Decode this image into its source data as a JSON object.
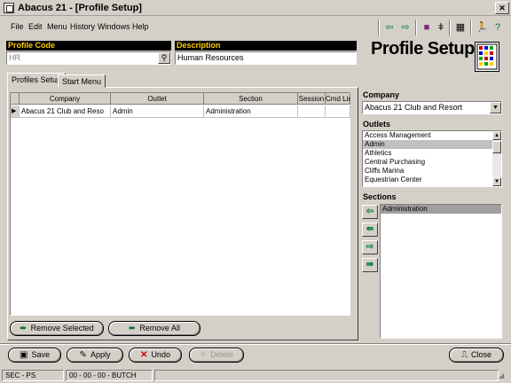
{
  "window": {
    "title": "Abacus 21 - [Profile Setup]"
  },
  "menu": [
    "File",
    "Edit",
    "Menu",
    "History",
    "Windows",
    "Help"
  ],
  "toolbar_icons": [
    "arrow-left-icon",
    "arrow-right-icon",
    "book-icon",
    "bell-icon",
    "calculator-icon",
    "running-man-icon",
    "help-icon"
  ],
  "header": {
    "profile_code_label": "Profile Code",
    "profile_code_value": "HR",
    "description_label": "Description",
    "description_value": "Human Resources",
    "page_title": "Profile Setup"
  },
  "tabs": [
    "Profiles Setup",
    "Start Menu"
  ],
  "grid": {
    "columns": [
      "Company",
      "Outlet",
      "Section",
      "Session",
      "Cmd Line"
    ],
    "rows": [
      [
        "Abacus 21 Club and Reso",
        "Admin",
        "Administration",
        "",
        ""
      ]
    ]
  },
  "left_buttons": {
    "remove_selected": "Remove Selected",
    "remove_all": "Remove All"
  },
  "company": {
    "label": "Company",
    "value": "Abacus 21 Club and Resort"
  },
  "outlets": {
    "label": "Outlets",
    "items": [
      "Access Management",
      "Admin",
      "Athletics",
      "Central Purchasing",
      "Cliffs Marina",
      "Equestrian Center"
    ],
    "selected": "Admin"
  },
  "sections": {
    "label": "Sections",
    "items": [
      "Administration"
    ]
  },
  "actions": {
    "save": "Save",
    "apply": "Apply",
    "undo": "Undo",
    "delete": "Delete",
    "close": "Close"
  },
  "status": {
    "left": "SEC - PS",
    "middle": "00 - 00 - 00 - BUTCH"
  },
  "colors": {
    "label_bg": "#000000",
    "label_fg": "#ffcc00",
    "arrow": "#007a3d",
    "undo_x": "#cc0000"
  }
}
